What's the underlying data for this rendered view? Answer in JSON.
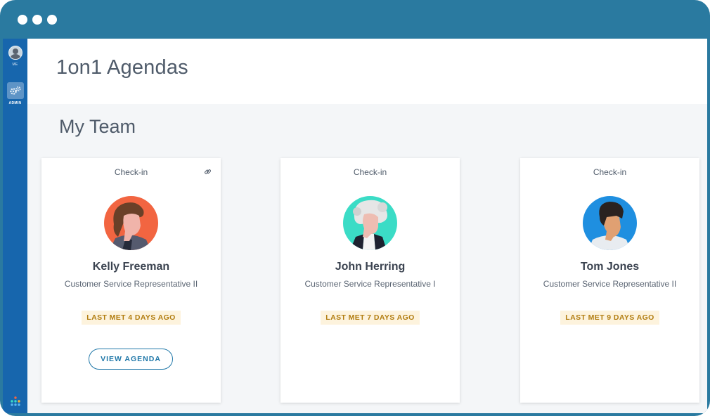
{
  "window": {
    "controls": [
      "dot",
      "dot",
      "dot"
    ]
  },
  "sidebar": {
    "items": [
      {
        "label": "ME",
        "icon": "user-avatar-icon"
      },
      {
        "label": "ADMIN",
        "icon": "gear-icon",
        "active": true
      }
    ],
    "bottom_icon": "apps-grid-icon"
  },
  "header": {
    "title": "1on1 Agendas"
  },
  "section": {
    "title": "My Team"
  },
  "cards": [
    {
      "type": "Check-in",
      "name": "Kelly Freeman",
      "role": "Customer Service Representative II",
      "last_met": "LAST MET 4 DAYS AGO",
      "action": "VIEW AGENDA",
      "avatar_bg": "#f26541"
    },
    {
      "type": "Check-in",
      "name": "John Herring",
      "role": "Customer Service Representative I",
      "last_met": "LAST MET 7 DAYS AGO",
      "avatar_bg": "#3bdcc6"
    },
    {
      "type": "Check-in",
      "name": "Tom Jones",
      "role": "Customer Service Representative II",
      "last_met": "LAST MET 9 DAYS AGO",
      "avatar_bg": "#1f8fe0"
    }
  ],
  "colors": {
    "frame": "#2a7aa0",
    "sidebar": "#1766ad",
    "badge_bg": "#fdf3dd",
    "badge_text": "#b27d10",
    "accent": "#1f77a8"
  }
}
